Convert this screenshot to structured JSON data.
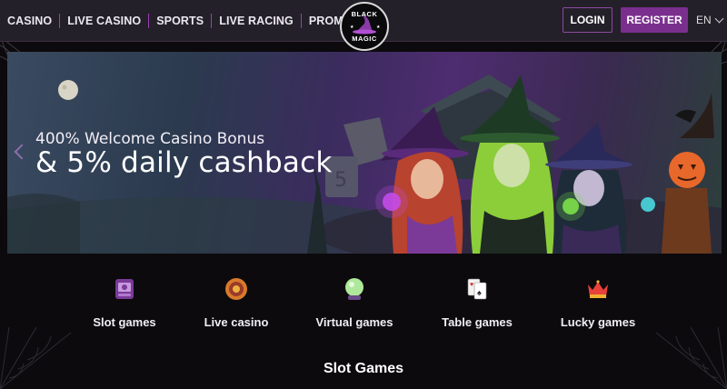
{
  "header": {
    "nav": [
      {
        "label": "CASINO"
      },
      {
        "label": "LIVE CASINO"
      },
      {
        "label": "SPORTS"
      },
      {
        "label": "LIVE RACING"
      },
      {
        "label": "PROMOTIONS"
      }
    ],
    "logo": {
      "top": "BLACK",
      "bottom": "MAGIC"
    },
    "login_label": "LOGIN",
    "register_label": "REGISTER",
    "language": "EN"
  },
  "hero": {
    "line1": "400% Welcome Casino Bonus",
    "line2": "& 5% daily cashback"
  },
  "categories": [
    {
      "label": "Slot games",
      "icon": "slot-machine-icon"
    },
    {
      "label": "Live casino",
      "icon": "casino-chip-icon"
    },
    {
      "label": "Virtual games",
      "icon": "crystal-ball-icon"
    },
    {
      "label": "Table games",
      "icon": "playing-cards-icon"
    },
    {
      "label": "Lucky games",
      "icon": "crown-icon"
    }
  ],
  "section": {
    "title": "Slot Games"
  },
  "colors": {
    "accent": "#7a2f8f",
    "header_bg": "#24202a",
    "page_bg": "#0c0a0d"
  }
}
